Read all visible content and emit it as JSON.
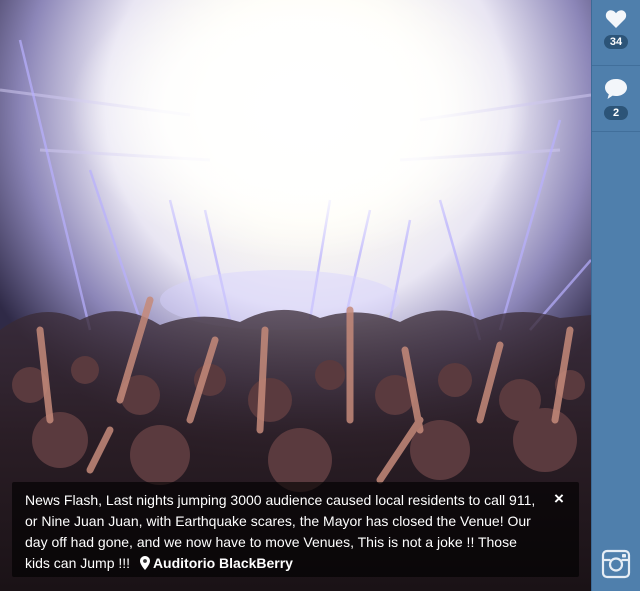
{
  "photo": {
    "alt": "Concert crowd with hands raised under bright stage lights"
  },
  "sidebar": {
    "likes_count": "34",
    "comments_count": "2",
    "like_icon": "heart-icon",
    "comment_icon": "speech-bubble-icon",
    "instagram_icon": "instagram-icon",
    "background_color": "#4f7fac",
    "badge_color": "#2c5478"
  },
  "caption": {
    "text": "News Flash, Last nights jumping 3000 audience caused local residents to call 911, or Nine Juan Juan, with Earthquake scares, the Mayor has closed the Venue! Our day off had gone, and we now have to move Venues, This is not a joke !! Those kids can Jump !!!",
    "location": "Auditorio BlackBerry",
    "close_label": "×",
    "location_icon": "map-pin-icon"
  }
}
